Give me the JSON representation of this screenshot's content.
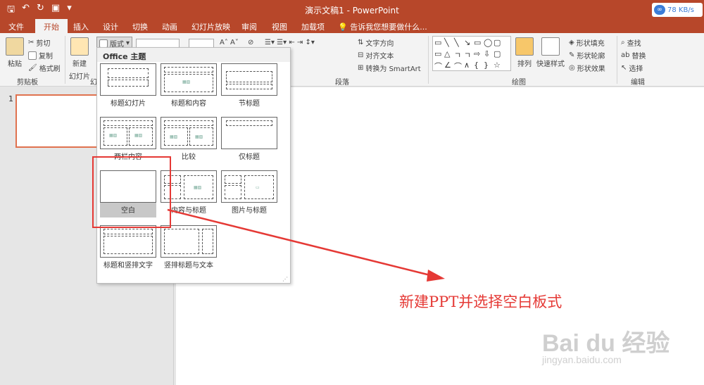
{
  "window": {
    "title": "演示文稿1 - PowerPoint"
  },
  "network": {
    "speed": "78 KB/s"
  },
  "tabs": [
    "文件",
    "开始",
    "插入",
    "设计",
    "切换",
    "动画",
    "幻灯片放映",
    "审阅",
    "视图",
    "加载项"
  ],
  "tell_me": "告诉我您想要做什么...",
  "clipboard": {
    "paste": "粘贴",
    "cut": "剪切",
    "copy": "复制",
    "format_painter": "格式刷",
    "group": "剪贴板"
  },
  "slides": {
    "new_slide": "新建",
    "new_slide2": "幻灯片",
    "layout": "版式",
    "group": "幻"
  },
  "paragraph": {
    "text_direction": "文字方向",
    "align_text": "对齐文本",
    "smartart": "转换为 SmartArt",
    "group": "段落"
  },
  "drawing": {
    "arrange": "排列",
    "quick_styles": "快速样式",
    "shape_fill": "形状填充",
    "shape_outline": "形状轮廓",
    "shape_effects": "形状效果",
    "group": "绘图"
  },
  "editing": {
    "find": "查找",
    "replace": "替换",
    "select": "选择",
    "group": "编辑"
  },
  "shapes_row1": [
    "▭",
    "╲",
    "╲",
    "↘",
    "▭",
    "◯",
    "▢"
  ],
  "shapes_row2": [
    "▭",
    "△",
    "ㄱ",
    "ㄱ",
    "⇨",
    "⇩",
    "▢"
  ],
  "shapes_row3": [
    "⌒",
    "∠",
    "⌒",
    "∧",
    "{",
    "}",
    "☆"
  ],
  "gallery": {
    "header": "Office 主题",
    "layouts": [
      "标题幻灯片",
      "标题和内容",
      "节标题",
      "两栏内容",
      "比较",
      "仅标题",
      "空白",
      "内容与标题",
      "图片与标题",
      "标题和竖排文字",
      "竖排标题与文本"
    ]
  },
  "slide_number": "1",
  "annotation": "新建PPT并选择空白板式",
  "watermark": {
    "logo": "Bai du 经验",
    "url": "jingyan.baidu.com"
  },
  "colors": {
    "accent": "#b7472a",
    "highlight": "#e53935"
  }
}
